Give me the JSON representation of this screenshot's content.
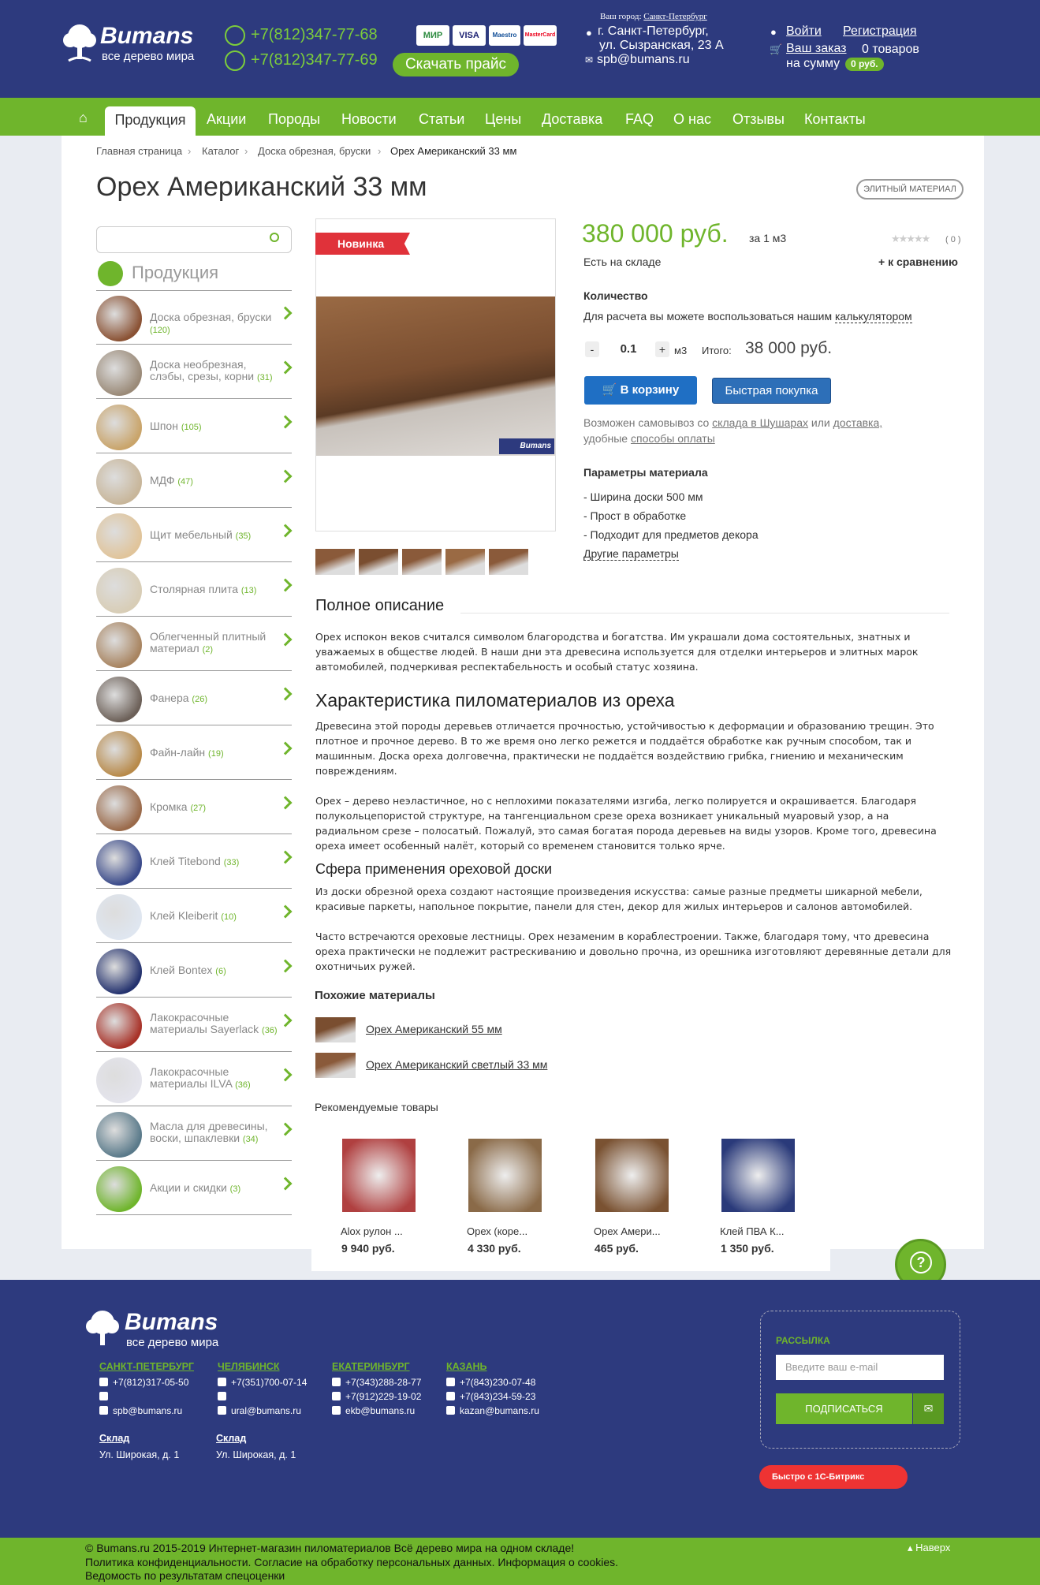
{
  "header": {
    "logo_text": "Bumans",
    "logo_sub": "все дерево мира",
    "phone1": "+7(812)347-77-68",
    "phone2": "+7(812)347-77-69",
    "payments": [
      "МИР",
      "VISA",
      "Maestro",
      "MasterCard"
    ],
    "price_button": "Скачать прайс",
    "city_label": "Ваш город:",
    "city": "Санкт-Петербург",
    "address_line1": "г. Санкт-Петербург,",
    "address_line2": "ул. Сызранская, 23 А",
    "email": "spb@bumans.ru",
    "login": "Войти",
    "register": "Регистрация",
    "order_label": "Ваш заказ",
    "items_count": "0 товаров",
    "sum_label": "на сумму",
    "sum_value": "0 руб."
  },
  "nav": {
    "items": [
      "Продукция",
      "Акции",
      "Породы",
      "Новости",
      "Статьи",
      "Цены",
      "Доставка",
      "FAQ",
      "О нас",
      "Отзывы",
      "Контакты"
    ],
    "active": "Продукция"
  },
  "breadcrumb": [
    "Главная страница",
    "Каталог",
    "Доска обрезная, бруски",
    "Орех Американский 33 мм"
  ],
  "product": {
    "title": "Орех Американский 33 мм",
    "badge": "ЭЛИТНЫЙ МАТЕРИАЛ",
    "ribbon": "Новинка",
    "price": "380 000 руб.",
    "price_unit": "за 1 м3",
    "rating_count": "( 0 )",
    "stock": "Есть на складе",
    "compare": "+ к сравнению",
    "qty_label": "Количество",
    "calc_text": "Для расчета вы можете воспользоваться нашим",
    "calc_link": "калькулятором",
    "qty_minus": "-",
    "qty_value": "0.1",
    "qty_plus": "+",
    "qty_unit": "м3",
    "total_label": "Итого:",
    "total_value": "38 000 руб.",
    "cart_button": "В корзину",
    "quick_button": "Быстрая покупка",
    "pickup_1": "Возможен самовывоз со",
    "pickup_link1": "склада в Шушарах",
    "pickup_or": "или",
    "pickup_link2": "доставка,",
    "pickup_2": "удобные",
    "pickup_link3": "способы оплаты",
    "params_title": "Параметры материала",
    "params": [
      "- Ширина доски 500 мм",
      "- Прост в обработке",
      "- Подходит для предметов декора"
    ],
    "more_params": "Другие параметры"
  },
  "sidebar": {
    "title": "Продукция",
    "items": [
      {
        "name": "Доска обрезная, бруски",
        "count": "(120)",
        "color": "#8a5234"
      },
      {
        "name": "Доска необрезная, слэбы, срезы, корни",
        "count": "(31)",
        "color": "#9a8a78"
      },
      {
        "name": "Шпон",
        "count": "(105)",
        "color": "#c9a46a"
      },
      {
        "name": "МДФ",
        "count": "(47)",
        "color": "#c8b69a"
      },
      {
        "name": "Щит мебельный",
        "count": "(35)",
        "color": "#e0c49a"
      },
      {
        "name": "Столярная плита",
        "count": "(13)",
        "color": "#d8cdb6"
      },
      {
        "name": "Облегченный плитный материал",
        "count": "(2)",
        "color": "#a88460"
      },
      {
        "name": "Фанера",
        "count": "(26)",
        "color": "#6c6058"
      },
      {
        "name": "Файн-лайн",
        "count": "(19)",
        "color": "#b88a4a"
      },
      {
        "name": "Кромка",
        "count": "(27)",
        "color": "#9a6a4a"
      },
      {
        "name": "Клей Titebond",
        "count": "(33)",
        "color": "#3a4a8a"
      },
      {
        "name": "Клей Kleiberit",
        "count": "(10)",
        "color": "#dfe6f0"
      },
      {
        "name": "Клей Bontex",
        "count": "(6)",
        "color": "#24326e"
      },
      {
        "name": "Лакокрасочные материалы Sayerlack",
        "count": "(36)",
        "color": "#a83228"
      },
      {
        "name": "Лакокрасочные материалы ILVA",
        "count": "(36)",
        "color": "#e4e4ec"
      },
      {
        "name": "Масла для древесины, воски, шпаклевки",
        "count": "(34)",
        "color": "#5a7a8a"
      },
      {
        "name": "Акции и скидки",
        "count": "(3)",
        "color": "#6fb52c"
      }
    ]
  },
  "description": {
    "title": "Полное описание",
    "intro": "Орех испокон веков считался символом благородства и богатства. Им украшали дома состоятельных, знатных и уважаемых в обществе людей. В наши дни эта древесина используется для отделки интерьеров и элитных марок автомобилей, подчеркивая респектабельность и особый статус хозяина.",
    "h_char": "Характеристика пиломатериалов из ореха",
    "char_p1": "Древесина этой породы деревьев отличается прочностью, устойчивостью к деформации и образованию трещин. Это плотное и прочное дерево. В то же время оно легко режется и поддаётся обработке как ручным способом, так и машинным. Доска ореха долговечна, практически не поддаётся воздействию грибка, гниению и механическим повреждениям.",
    "char_p2": "Орех – дерево неэластичное, но с неплохими показателями изгиба, легко полируется и окрашивается. Благодаря полукольцепористой структуре, на тангенциальном срезе ореха возникает уникальный муаровый узор, а на радиальном срезе – полосатый. Пожалуй, это самая богатая порода деревьев на виды узоров. Кроме того, древесина ореха имеет особенный налёт, который со временем становится только ярче.",
    "h_use": "Сфера применения ореховой доски",
    "use_p1": "Из доски обрезной ореха создают настоящие произведения искусства: самые разные предметы шикарной мебели, красивые паркеты, напольное покрытие, панели для стен, декор для жилых интерьеров и салонов автомобилей.",
    "use_p2": "Часто встречаются ореховые лестницы. Орех незаменим в кораблестроении. Также, благодаря тому, что древесина ореха практически не подлежит растрескиванию и довольно прочна, из орешника изготовляют деревянные детали для охотничьих ружей."
  },
  "similar": {
    "title": "Похожие материалы",
    "items": [
      "Орех Американский 55 мм",
      "Орех Американский светлый 33 мм"
    ]
  },
  "recommended": {
    "title": "Рекомендуемые товары",
    "items": [
      {
        "name": "Alox рулон ...",
        "price": "9 940 руб.",
        "color": "#b04040"
      },
      {
        "name": "Орех (коре...",
        "price": "4 330 руб.",
        "color": "#8a6a48"
      },
      {
        "name": "Орех Амери...",
        "price": "465 руб.",
        "color": "#7a5232"
      },
      {
        "name": "Клей ПВА К...",
        "price": "1 350 руб.",
        "color": "#2a3a7a"
      }
    ]
  },
  "footer": {
    "logo_text": "Bumans",
    "logo_sub": "все дерево мира",
    "cities": [
      {
        "name": "САНКТ-ПЕТЕРБУРГ",
        "phone1": "+7(812)317-05-50",
        "phone2": "",
        "email": "spb@bumans.ru"
      },
      {
        "name": "ЧЕЛЯБИНСК",
        "phone1": "+7(351)700-07-14",
        "phone2": "",
        "email": "ural@bumans.ru"
      },
      {
        "name": "ЕКАТЕРИНБУРГ",
        "phone1": "+7(343)288-28-77",
        "phone2": "+7(912)229-19-02",
        "email": "ekb@bumans.ru"
      },
      {
        "name": "КАЗАНЬ",
        "phone1": "+7(843)230-07-48",
        "phone2": "+7(843)234-59-23",
        "email": "kazan@bumans.ru"
      }
    ],
    "warehouse_label": "Склад",
    "warehouse_addr": "Ул. Широкая, д. 1",
    "newsletter_title": "РАССЫЛКА",
    "email_placeholder": "Введите ваш e-mail",
    "subscribe": "ПОДПИСАТЬСЯ",
    "bitrix": "Быстро с 1С-Битрикс",
    "copyright": "© Bumans.ru 2015-2019 Интернет-магазин пиломатериалов Всё дерево мира на одном складе!",
    "privacy": "Политика конфиденциальности",
    "consent": "Согласие на обработку персональных данных",
    "cookies": "Информация о cookies",
    "report": "Ведомость по результатам спецоценки",
    "up": "Наверх"
  },
  "help_icon": "?",
  "colors": {
    "header": "#2d3a7e",
    "accent": "#6fb52c",
    "blue_btn": "#1f6fc4"
  }
}
